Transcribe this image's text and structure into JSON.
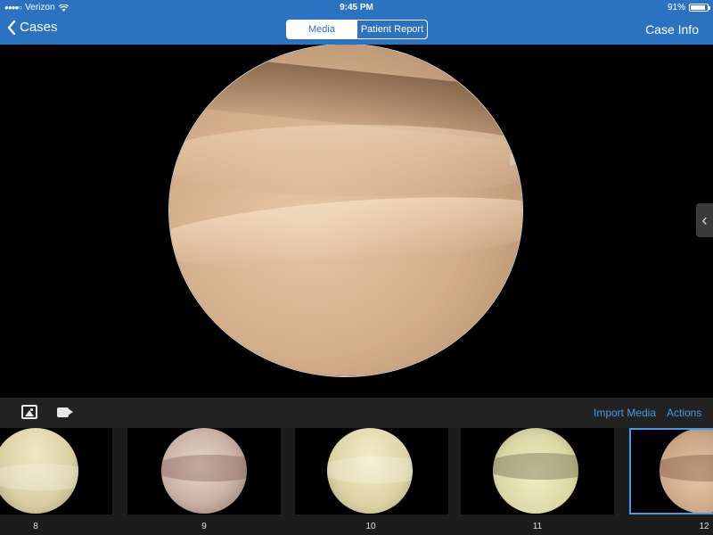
{
  "status_bar": {
    "carrier": "Verizon",
    "time": "9:45 PM",
    "battery": "91%",
    "battery_level": 0.91
  },
  "nav": {
    "back_label": "Cases",
    "segments": [
      {
        "label": "Media",
        "active": true
      },
      {
        "label": "Patient Report",
        "active": false
      }
    ],
    "right_label": "Case Info"
  },
  "toolbar": {
    "icons": [
      "photo-icon",
      "video-camera-icon"
    ],
    "import_label": "Import Media",
    "actions_label": "Actions"
  },
  "thumbnails": [
    {
      "label": "8"
    },
    {
      "label": "9"
    },
    {
      "label": "10"
    },
    {
      "label": "11"
    },
    {
      "label": "12",
      "selected": true
    }
  ],
  "colors": {
    "header": "#2b72c1",
    "accent": "#4a98e8"
  }
}
